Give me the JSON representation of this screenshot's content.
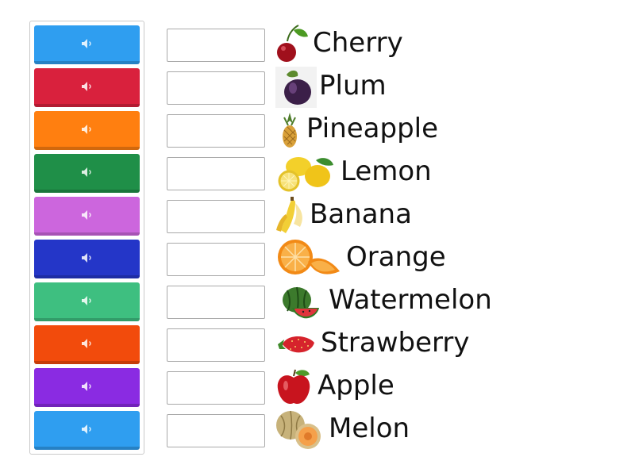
{
  "items": [
    {
      "label": "Cherry",
      "color": "#2f9ef0",
      "icon": "cherry-icon"
    },
    {
      "label": "Plum",
      "color": "#d9213d",
      "icon": "plum-icon"
    },
    {
      "label": "Pineapple",
      "color": "#ff7f10",
      "icon": "pineapple-icon"
    },
    {
      "label": "Lemon",
      "color": "#1f8f48",
      "icon": "lemon-icon"
    },
    {
      "label": "Banana",
      "color": "#cc66dd",
      "icon": "banana-icon"
    },
    {
      "label": "Orange",
      "color": "#2436c8",
      "icon": "orange-icon"
    },
    {
      "label": "Watermelon",
      "color": "#3ebf80",
      "icon": "watermelon-icon"
    },
    {
      "label": "Strawberry",
      "color": "#f24b0c",
      "icon": "strawberry-icon"
    },
    {
      "label": "Apple",
      "color": "#8a2be2",
      "icon": "apple-icon"
    },
    {
      "label": "Melon",
      "color": "#2f9ef0",
      "icon": "melon-icon"
    }
  ]
}
